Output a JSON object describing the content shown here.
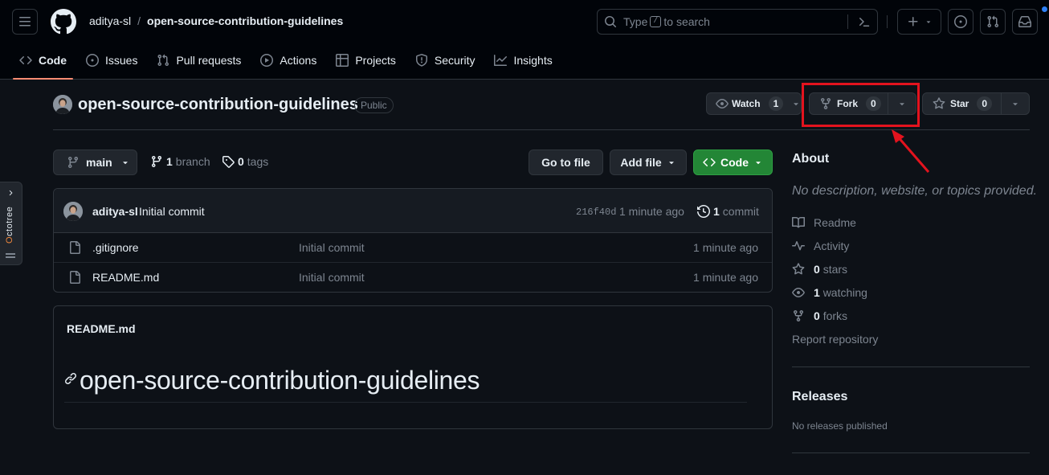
{
  "header": {
    "owner": "aditya-sl",
    "separator": "/",
    "repo": "open-source-contribution-guidelines",
    "search": {
      "prefix": "Type",
      "key": "/",
      "suffix": "to search"
    }
  },
  "nav": {
    "tabs": [
      {
        "label": "Code",
        "icon": "code-icon",
        "active": true
      },
      {
        "label": "Issues",
        "icon": "issue-icon"
      },
      {
        "label": "Pull requests",
        "icon": "pull-request-icon"
      },
      {
        "label": "Actions",
        "icon": "play-icon"
      },
      {
        "label": "Projects",
        "icon": "table-icon"
      },
      {
        "label": "Security",
        "icon": "shield-icon"
      },
      {
        "label": "Insights",
        "icon": "graph-icon"
      }
    ]
  },
  "octotree": {
    "label_o": "O",
    "label_rest": "ctotree"
  },
  "repo": {
    "name": "open-source-contribution-guidelines",
    "visibility": "Public",
    "watch": {
      "label": "Watch",
      "count": "1"
    },
    "fork": {
      "label": "Fork",
      "count": "0"
    },
    "star": {
      "label": "Star",
      "count": "0"
    }
  },
  "toolbar": {
    "branch": "main",
    "branches_count": "1",
    "branches_label": "branch",
    "tags_count": "0",
    "tags_label": "tags",
    "goto_file": "Go to file",
    "add_file": "Add file",
    "code": "Code"
  },
  "commit": {
    "author": "aditya-sl",
    "message": "Initial commit",
    "hash": "216f40d",
    "time": "1 minute ago",
    "count": "1",
    "count_label": "commit"
  },
  "files": [
    {
      "name": ".gitignore",
      "message": "Initial commit",
      "time": "1 minute ago"
    },
    {
      "name": "README.md",
      "message": "Initial commit",
      "time": "1 minute ago"
    }
  ],
  "readme": {
    "label": "README.md",
    "heading": "open-source-contribution-guidelines"
  },
  "sidebar": {
    "about_title": "About",
    "description": "No description, website, or topics provided.",
    "readme": "Readme",
    "activity": "Activity",
    "stars_count": "0",
    "stars_label": "stars",
    "watching_count": "1",
    "watching_label": "watching",
    "forks_count": "0",
    "forks_label": "forks",
    "report": "Report repository",
    "releases_title": "Releases",
    "releases_empty": "No releases published"
  },
  "colors": {
    "background": "#0d1117",
    "header_bg": "#010409",
    "accent_tab": "#fd8c73",
    "code_button": "#238636",
    "annotation": "#e3131e"
  }
}
